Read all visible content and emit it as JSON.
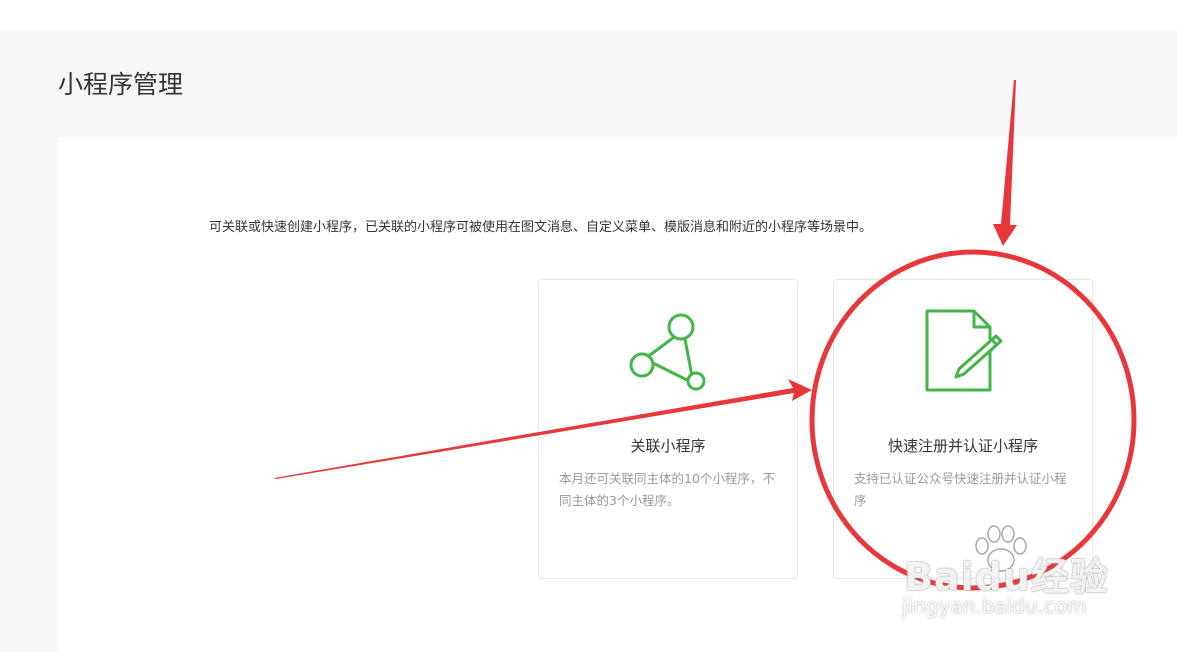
{
  "page": {
    "title": "小程序管理",
    "intro": "可关联或快速创建小程序，已关联的小程序可被使用在图文消息、自定义菜单、模版消息和附近的小程序等场景中。"
  },
  "cards": [
    {
      "title": "关联小程序",
      "desc": "本月还可关联同主体的10个小程序，不同主体的3个小程序。",
      "icon": "link-nodes-icon"
    },
    {
      "title": "快速注册并认证小程序",
      "desc": "支持已认证公众号快速注册并认证小程序",
      "icon": "document-edit-icon"
    }
  ],
  "watermark": {
    "brand": "Baidu经验",
    "url": "jingyan.baidu.com"
  },
  "colors": {
    "accent_green": "#44b549",
    "annotation_red": "#e8373b",
    "page_bg": "#f6f7f8",
    "card_border": "#e7e7eb"
  }
}
